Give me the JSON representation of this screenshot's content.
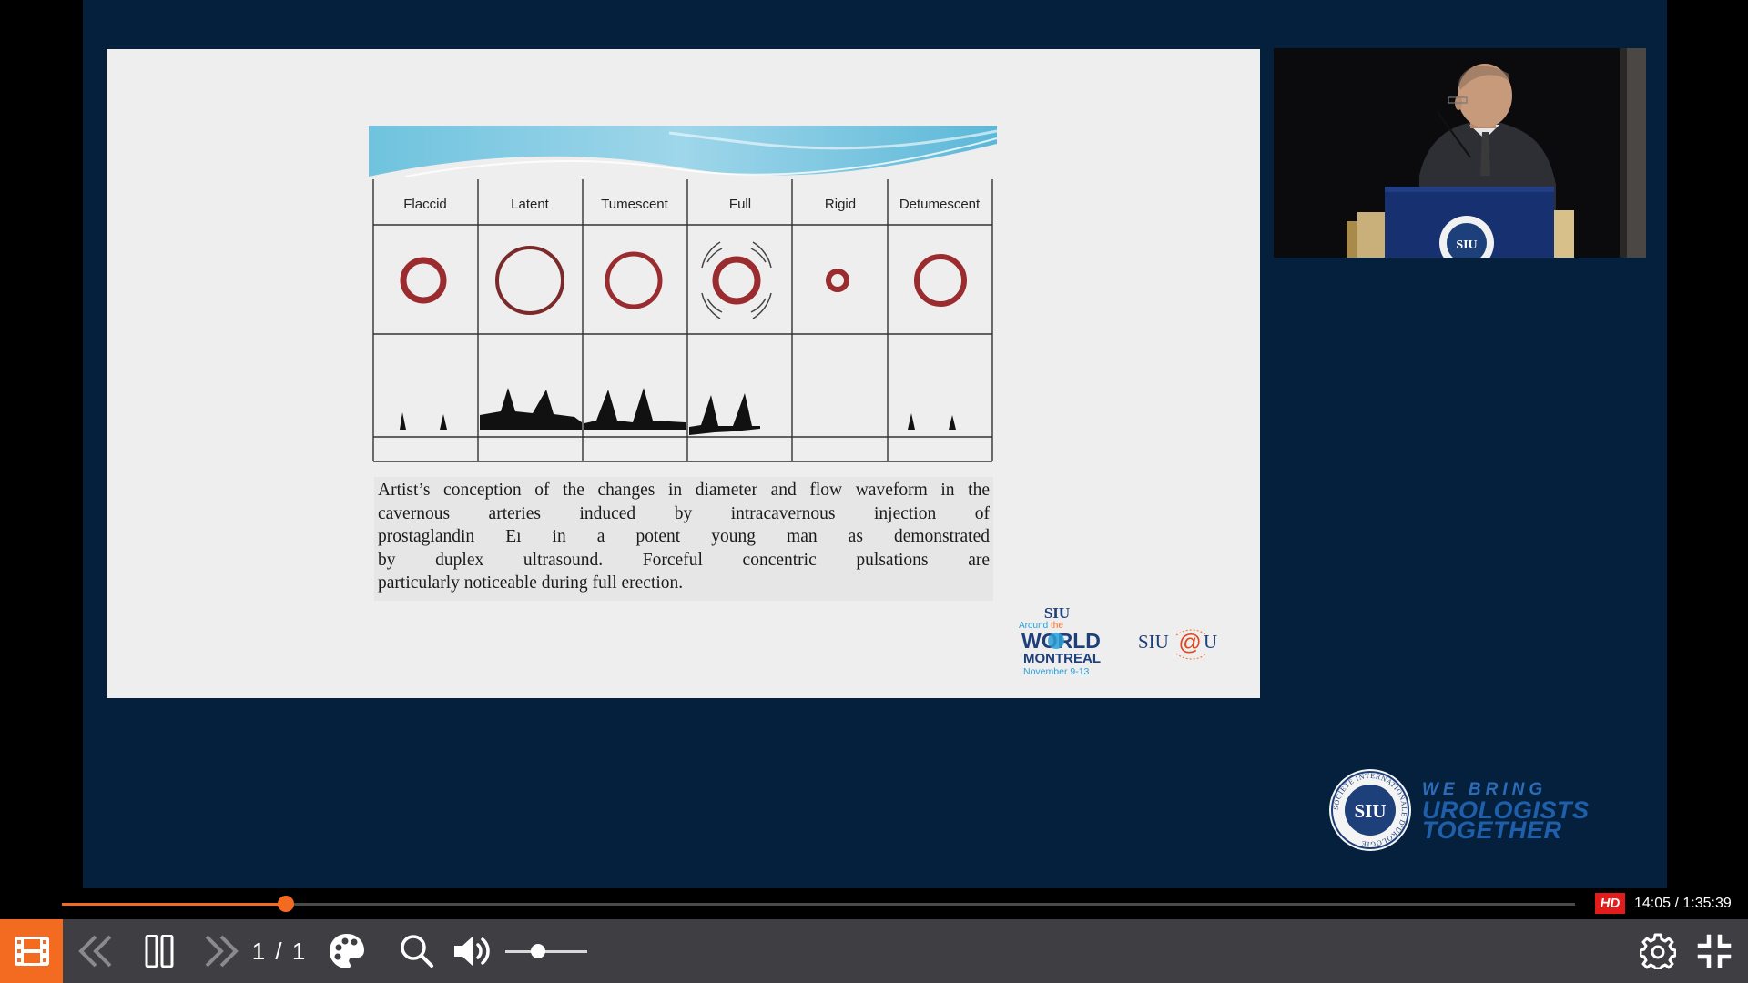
{
  "slide": {
    "figure": {
      "columns": [
        "Flaccid",
        "Latent",
        "Tumescent",
        "Full",
        "Rigid",
        "Detumescent"
      ]
    },
    "caption_lines": [
      "Artist’s conception of  the changes  in  diameter and flow waveform in  the",
      "cavernous  arteries induced by intracavernous  injection      of",
      "prostaglandin    Eı  in a    potent    young      man    as      demonstrated",
      "by    duplex    ultrasound.    Forceful      concentric      pulsations      are",
      "particularly noticeable      during      full      erection."
    ],
    "logo_world": {
      "siu": "SIU",
      "around": "Around",
      "the": "the",
      "world": "WORLD",
      "city": "MONTREAL",
      "dates": "November 9-13"
    },
    "logo_siu_at_u": "SIU@U"
  },
  "brand": {
    "seal_text": "SIU",
    "seal_ring_text": "SOCIÉTÉ INTERNATIONALE D'UROLOGIE",
    "line1": "WE BRING",
    "line2": "UROLOGISTS",
    "line3": "TOGETHER"
  },
  "webcam": {
    "podium_seal_text": "SIU"
  },
  "player": {
    "progress": {
      "fraction": 0.1478,
      "hd_label": "HD",
      "time_display": "14:05 / 1:35:39"
    },
    "page_counter": "1 / 1",
    "volume_level": 0.4,
    "accent_color": "#f26b21",
    "icons": {
      "slides": "film-icon",
      "prev": "double-chevron-left-icon",
      "pause": "pause-icon",
      "next": "double-chevron-right-icon",
      "palette": "palette-icon",
      "zoom": "search-icon",
      "volume": "volume-icon",
      "settings": "gear-icon",
      "fullscreen_exit": "exit-fullscreen-icon"
    }
  }
}
